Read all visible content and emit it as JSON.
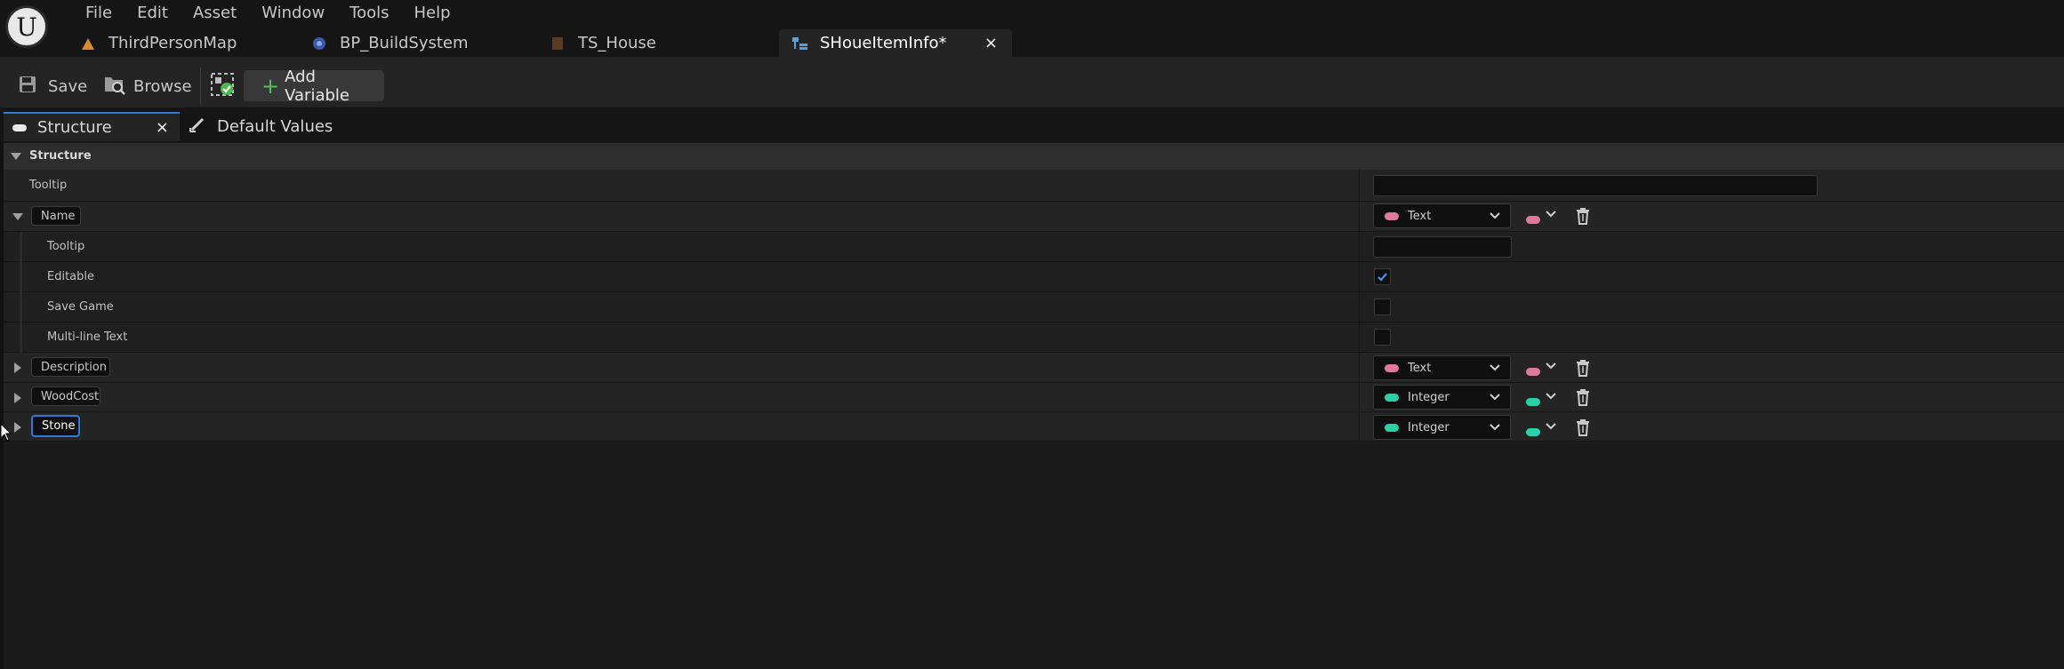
{
  "menu": [
    "File",
    "Edit",
    "Asset",
    "Window",
    "Tools",
    "Help"
  ],
  "doc_tabs": [
    {
      "label": "ThirdPersonMap",
      "icon": "level-icon"
    },
    {
      "label": "BP_BuildSystem",
      "icon": "blueprint-icon"
    },
    {
      "label": "TS_House",
      "icon": "texture-icon"
    },
    {
      "label": "SHoueItemInfo*",
      "icon": "structure-icon",
      "active": true,
      "close": "×"
    }
  ],
  "toolbar": {
    "save": "Save",
    "browse": "Browse",
    "add_variable": "Add Variable"
  },
  "panel_tabs": {
    "structure": "Structure",
    "close": "×",
    "default_values": "Default Values"
  },
  "section_title": "Structure",
  "rows": {
    "tooltip_label": "Tooltip",
    "name": {
      "label": "Name",
      "type": "Text"
    },
    "name_sub": {
      "tooltip": "Tooltip",
      "editable": "Editable",
      "save_game": "Save Game",
      "multiline": "Multi-line Text"
    },
    "description": {
      "label": "Description",
      "type": "Text"
    },
    "woodcost": {
      "label": "WoodCost",
      "type": "Integer"
    },
    "stone": {
      "label": "Stone",
      "type": "Integer"
    }
  },
  "colors": {
    "text_pin": "#e07a9c",
    "integer_pin": "#2bd1a6",
    "accent": "#2f7ad6"
  },
  "editable_checked": true
}
